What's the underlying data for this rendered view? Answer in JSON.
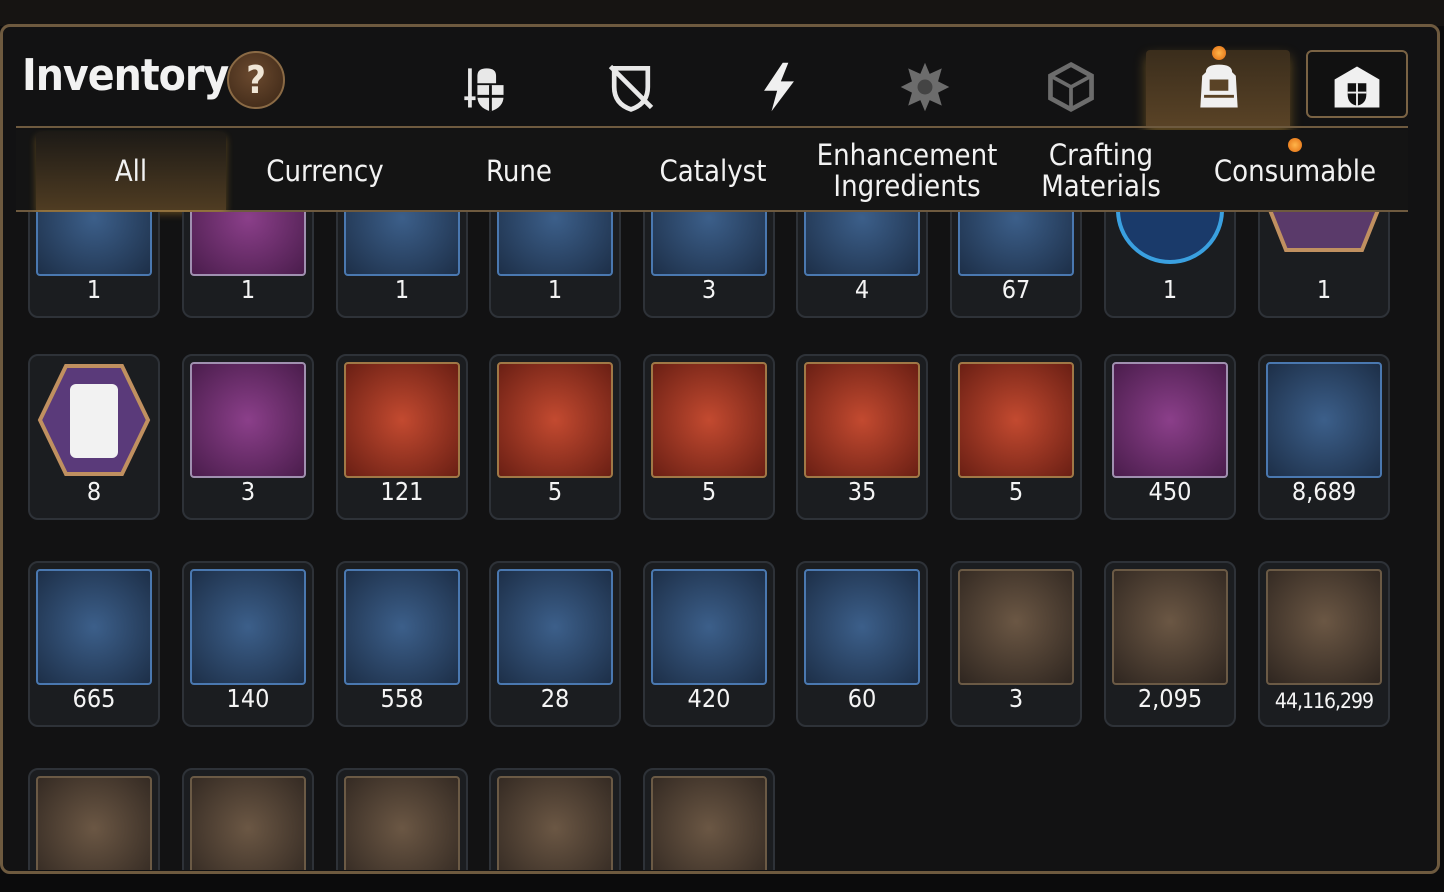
{
  "header": {
    "title": "Inventory",
    "help_label": "?"
  },
  "category_icons": [
    {
      "name": "equipment-icon"
    },
    {
      "name": "defense-icon"
    },
    {
      "name": "energy-icon"
    },
    {
      "name": "emblem-icon"
    },
    {
      "name": "cube-icon"
    },
    {
      "name": "bag-icon",
      "selected": true
    },
    {
      "name": "guild-icon"
    }
  ],
  "subtabs": [
    {
      "label": "All",
      "active": true
    },
    {
      "label": "Currency"
    },
    {
      "label": "Rune"
    },
    {
      "label": "Catalyst"
    },
    {
      "label": "Enhancement\nIngredients"
    },
    {
      "label": "Crafting\nMaterials"
    },
    {
      "label": "Consumable"
    }
  ],
  "items": [
    [
      "1",
      "1",
      "1",
      "1",
      "3",
      "4",
      "67",
      "1",
      "1"
    ],
    [
      "8",
      "3",
      "121",
      "5",
      "5",
      "35",
      "5",
      "450",
      "8,689"
    ],
    [
      "665",
      "140",
      "558",
      "28",
      "420",
      "60",
      "3",
      "2,095",
      "44,116,299"
    ],
    [
      "",
      "",
      "",
      "",
      ""
    ]
  ],
  "colors": {
    "accent_gold": "#6e5a3f",
    "notification": "#e06a10"
  }
}
